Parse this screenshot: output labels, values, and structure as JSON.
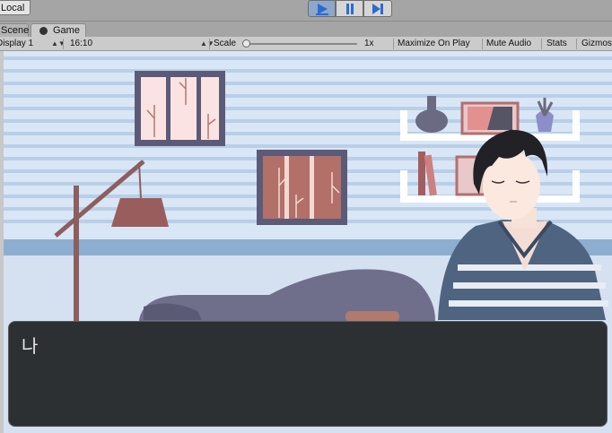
{
  "toolbar_top": {
    "local_label": "Local",
    "play_icon": "play-icon",
    "pause_icon": "pause-icon",
    "step_icon": "step-icon",
    "play_active_color": "#2a6bd4"
  },
  "tabs": [
    {
      "label": "Scene"
    },
    {
      "label": "Game"
    }
  ],
  "game_toolbar": {
    "display": "Display 1",
    "aspect": "16:10",
    "scale_label": "Scale",
    "scale_value": "1x",
    "maximize": "Maximize On Play",
    "mute": "Mute Audio",
    "stats": "Stats",
    "gizmos": "Gizmos"
  },
  "dialog": {
    "speaker": "나",
    "text": ""
  },
  "colors": {
    "wall": "#d9e6f5",
    "stripe": "#b9cfe8",
    "baseboard": "#8eaed1",
    "floor": "#d5e1f0",
    "dialog_bg": "#2d3033"
  }
}
